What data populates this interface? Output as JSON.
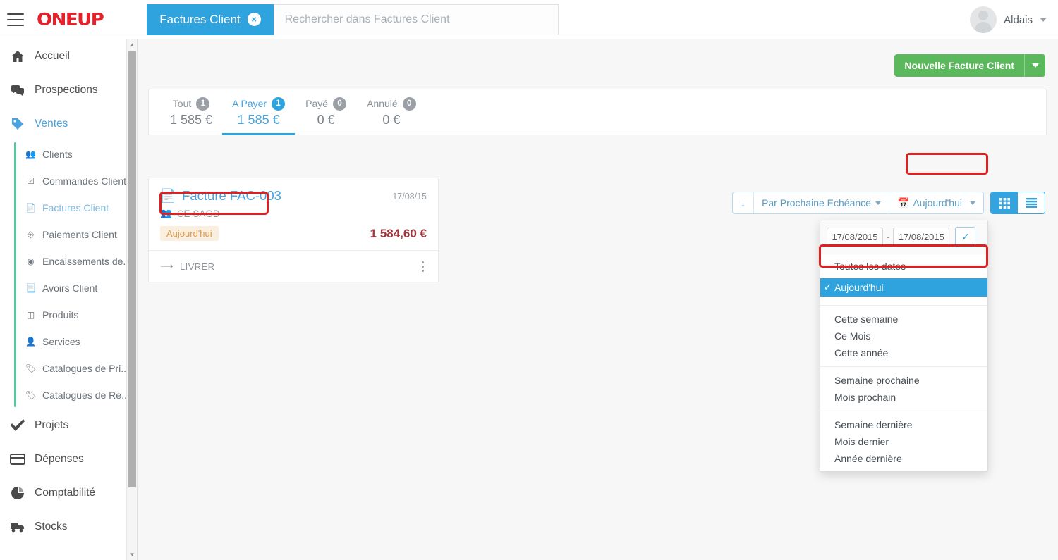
{
  "topbar": {
    "menu_icon": "hamburger-icon",
    "logo_text": "ONEUP",
    "module_chip_label": "Factures Client",
    "module_chip_close": "×",
    "search_placeholder": "Rechercher dans Factures Client",
    "search_value": "",
    "user_name": "Aldais"
  },
  "sidebar": {
    "items": [
      {
        "label": "Accueil",
        "icon": "home-icon"
      },
      {
        "label": "Prospections",
        "icon": "chat-icon"
      },
      {
        "label": "Ventes",
        "icon": "tag-icon"
      }
    ],
    "sub_items": [
      {
        "label": "Clients",
        "icon": "people-icon"
      },
      {
        "label": "Commandes Client",
        "icon": "order-check-icon"
      },
      {
        "label": "Factures Client",
        "icon": "invoice-icon"
      },
      {
        "label": "Paiements Client",
        "icon": "payment-icon"
      },
      {
        "label": "Encaissements de...",
        "icon": "coin-icon"
      },
      {
        "label": "Avoirs Client",
        "icon": "credit-note-icon"
      },
      {
        "label": "Produits",
        "icon": "box-icon"
      },
      {
        "label": "Services",
        "icon": "service-icon"
      },
      {
        "label": "Catalogues de Pri...",
        "icon": "price-tag-icon"
      },
      {
        "label": "Catalogues de Re...",
        "icon": "discount-tag-icon"
      }
    ],
    "bottom_items": [
      {
        "label": "Projets",
        "icon": "check-icon"
      },
      {
        "label": "Dépenses",
        "icon": "card-icon"
      },
      {
        "label": "Comptabilité",
        "icon": "pie-chart-icon"
      },
      {
        "label": "Stocks",
        "icon": "truck-icon"
      }
    ]
  },
  "main": {
    "new_invoice_button": "Nouvelle Facture Client",
    "stats": [
      {
        "label": "Tout",
        "count": "1",
        "amount": "1 585 €",
        "active": false
      },
      {
        "label": "A Payer",
        "count": "1",
        "amount": "1 585 €",
        "active": true
      },
      {
        "label": "Payé",
        "count": "0",
        "amount": "0 €",
        "active": false
      },
      {
        "label": "Annulé",
        "count": "0",
        "amount": "0 €",
        "active": false
      }
    ],
    "toolbar": {
      "sort_direction_icon": "arrow-down-icon",
      "sort_label": "Par Prochaine Echéance",
      "date_filter_label": "Aujourd'hui",
      "view_grid_icon": "grid-view-icon",
      "view_list_icon": "list-view-icon"
    },
    "date_dropdown": {
      "date_from": "17/08/2015",
      "date_to": "17/08/2015",
      "separator": "-",
      "confirm_icon": "check-icon",
      "group1": [
        "Toutes les dates"
      ],
      "selected": "Aujourd'hui",
      "group2": [
        "Cette semaine",
        "Ce Mois",
        "Cette année"
      ],
      "group3": [
        "Semaine prochaine",
        "Mois prochain"
      ],
      "group4": [
        "Semaine dernière",
        "Mois dernier",
        "Année dernière"
      ]
    },
    "invoice_card": {
      "title": "Facture FAC-003",
      "date": "17/08/15",
      "client": "CE SAGD",
      "status_badge": "Aujourd'hui",
      "amount": "1 584,60 €",
      "action_label": "LIVRER"
    }
  },
  "colors": {
    "brand_red": "#e8202a",
    "accent_blue": "#2fa3dd",
    "green": "#5cb85c",
    "sub_accent_green": "#5dc39a",
    "annotation_red": "#e02020",
    "amount_red": "#a1353c",
    "badge_bg": "#fbf0e0",
    "badge_text": "#d99a52"
  }
}
